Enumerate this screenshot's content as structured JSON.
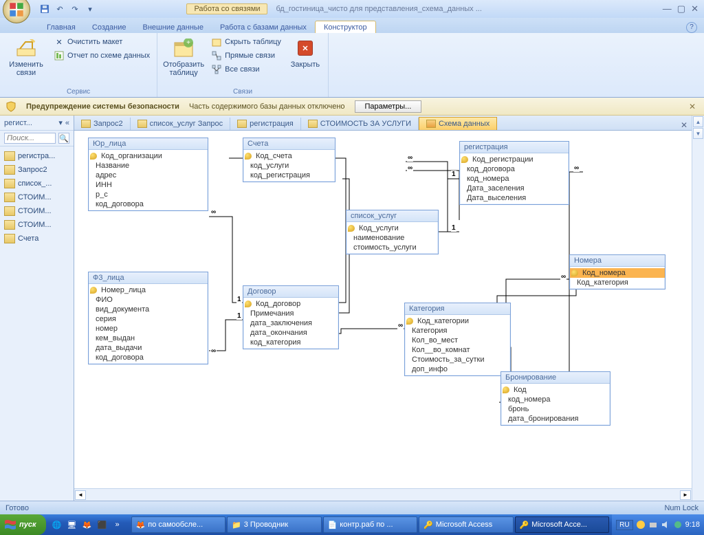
{
  "titlebar": {
    "context_label": "Работа со связями",
    "doc_title": "бд_гостиница_чисто для представления_схема_данных ..."
  },
  "ribbon_tabs": [
    "Главная",
    "Создание",
    "Внешние данные",
    "Работа с базами данных"
  ],
  "ribbon_ctx_tab": "Конструктор",
  "ribbon": {
    "g1_label": "Сервис",
    "edit_rel": "Изменить\nсвязи",
    "clear_layout": "Очистить макет",
    "rel_report": "Отчет по схеме данных",
    "g2_label": "Связи",
    "show_table": "Отобразить\nтаблицу",
    "hide_table": "Скрыть таблицу",
    "direct_rel": "Прямые связи",
    "all_rel": "Все связи",
    "close": "Закрыть"
  },
  "security": {
    "title": "Предупреждение системы безопасности",
    "msg": "Часть содержимого базы данных отключено",
    "btn": "Параметры..."
  },
  "nav": {
    "header": "регист...",
    "search_ph": "Поиск...",
    "items": [
      "регистра...",
      "Запрос2",
      "список_...",
      "СТОИМ...",
      "СТОИМ...",
      "СТОИМ...",
      "Счета"
    ]
  },
  "doctabs": [
    "Запрос2",
    "список_услуг Запрос",
    "регистрация",
    "СТОИМОСТЬ ЗА УСЛУГИ"
  ],
  "doctab_active": "Схема данных",
  "tables": {
    "jur": {
      "title": "Юр_лица",
      "fields": [
        "Код_организации",
        "Название",
        "адрес",
        "ИНН",
        "р_с",
        "код_договора"
      ],
      "pk": [
        0
      ]
    },
    "scheta": {
      "title": "Счета",
      "fields": [
        "Код_счета",
        "код_услуги",
        "код_регистрация"
      ],
      "pk": [
        0
      ]
    },
    "reg": {
      "title": "регистрация",
      "fields": [
        "Код_регистрации",
        "код_договора",
        "код_номера",
        "Дата_заселения",
        "Дата_выселения"
      ],
      "pk": [
        0
      ]
    },
    "uslugi": {
      "title": "список_услуг",
      "fields": [
        "Код_услуги",
        "наименование",
        "стоимость_услуги"
      ],
      "pk": [
        0
      ]
    },
    "nomera": {
      "title": "Номера",
      "fields": [
        "Код_номера",
        "Код_категория"
      ],
      "pk": [
        0
      ],
      "sel": 0
    },
    "fiz": {
      "title": "Ф3_лица",
      "fields": [
        "Номер_лица",
        "ФИО",
        "вид_документа",
        "серия",
        "номер",
        "кем_выдан",
        "дата_выдачи",
        "код_договора"
      ],
      "pk": [
        0
      ]
    },
    "dogovor": {
      "title": "Договор",
      "fields": [
        "Код_договор",
        "Примечания",
        "дата_заключения",
        "дата_окончания",
        "код_категория"
      ],
      "pk": [
        0
      ]
    },
    "kategoria": {
      "title": "Категория",
      "fields": [
        "Код_категории",
        "Категория",
        "Кол_во_мест",
        "Кол__во_комнат",
        "Стоимость_за_сутки",
        "доп_инфо"
      ],
      "pk": [
        0
      ]
    },
    "bron": {
      "title": "Бронирование",
      "fields": [
        "Код",
        "код_номера",
        "бронь",
        "дата_бронирования"
      ],
      "pk": [
        0
      ]
    }
  },
  "status": {
    "left": "Готово",
    "right": "Num Lock"
  },
  "taskbar": {
    "start": "пуск",
    "tasks": [
      "по самообсле...",
      "3 Проводник",
      "контр.раб по ...",
      "Microsoft Access",
      "Microsoft Acce..."
    ],
    "lang": "RU",
    "clock": "9:18"
  }
}
